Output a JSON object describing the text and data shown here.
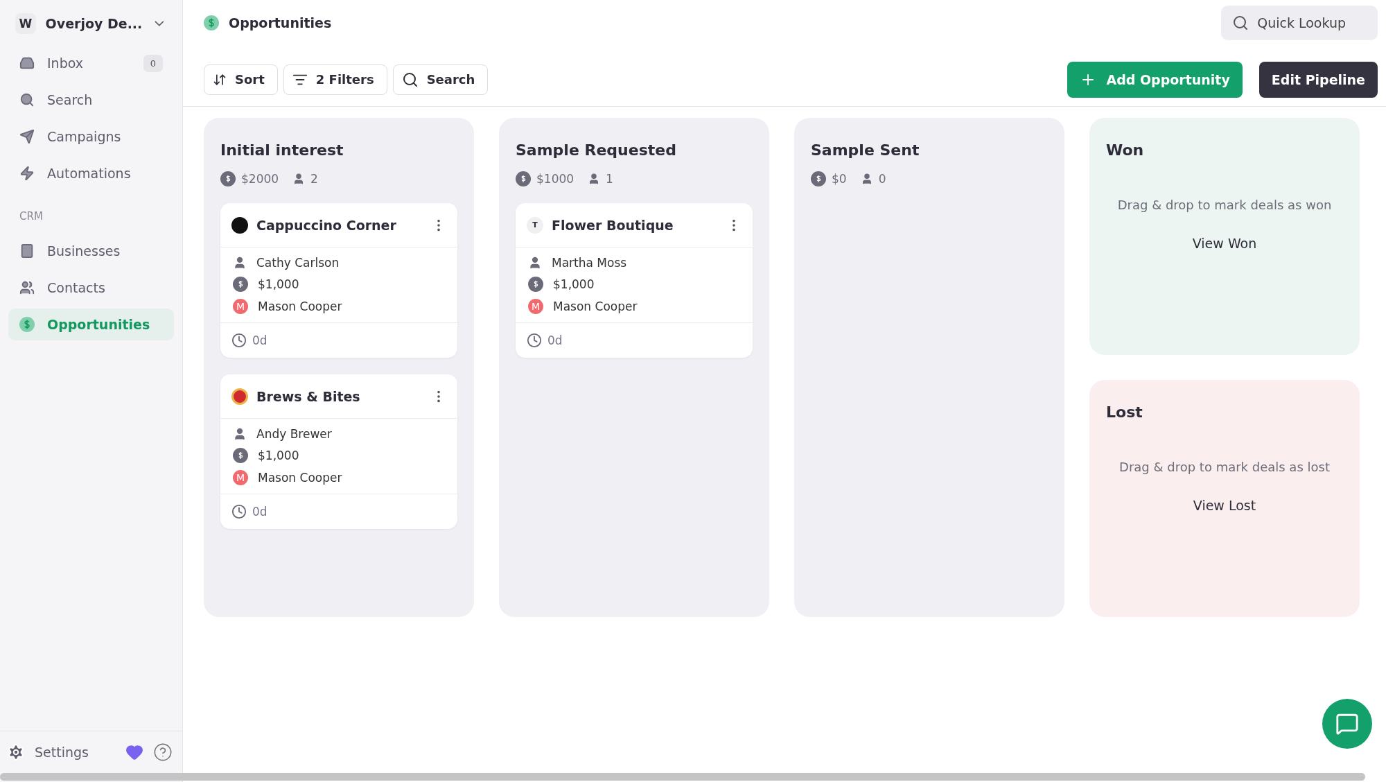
{
  "workspace": {
    "initial": "W",
    "name": "Overjoy De..."
  },
  "nav": [
    {
      "label": "Inbox",
      "kind": "inbox",
      "badge": "0",
      "selected": false
    },
    {
      "label": "Search",
      "kind": "search",
      "selected": false
    },
    {
      "label": "Campaigns",
      "kind": "send",
      "selected": false
    },
    {
      "label": "Automations",
      "kind": "bolt",
      "selected": false
    }
  ],
  "crm_section": {
    "heading": "CRM",
    "items": [
      {
        "label": "Businesses",
        "kind": "building",
        "selected": false
      },
      {
        "label": "Contacts",
        "kind": "contacts",
        "selected": false
      },
      {
        "label": "Opportunities",
        "kind": "dollar",
        "selected": true
      }
    ]
  },
  "sidebar_footer": {
    "settings": "Settings"
  },
  "header": {
    "title": "Opportunities",
    "quick_lookup": "Quick Lookup"
  },
  "toolbar": {
    "sort": "Sort",
    "filters": "2 Filters",
    "search": "Search",
    "add": "Add Opportunity",
    "edit": "Edit Pipeline"
  },
  "columns": [
    {
      "kind": "stage",
      "title": "Initial interest",
      "total": "$2000",
      "count": "2",
      "cards": [
        {
          "name": "Cappuccino Corner",
          "logo": {
            "kind": "dark"
          },
          "contact": "Cathy Carlson",
          "value": "$1,000",
          "owner_initial": "M",
          "owner": "Mason Cooper",
          "age": "0d"
        },
        {
          "name": "Brews & Bites",
          "logo": {
            "kind": "badge"
          },
          "contact": "Andy Brewer",
          "value": "$1,000",
          "owner_initial": "M",
          "owner": "Mason Cooper",
          "age": "0d"
        }
      ]
    },
    {
      "kind": "stage",
      "title": "Sample Requested",
      "total": "$1000",
      "count": "1",
      "cards": [
        {
          "name": "Flower Boutique",
          "logo": {
            "kind": "letter",
            "letter": "T"
          },
          "contact": "Martha Moss",
          "value": "$1,000",
          "owner_initial": "M",
          "owner": "Mason Cooper",
          "age": "0d"
        }
      ]
    },
    {
      "kind": "stage",
      "title": "Sample Sent",
      "total": "$0",
      "count": "0"
    },
    {
      "kind": "won",
      "title": "Won",
      "hint": "Drag & drop to mark deals as won",
      "link": "View Won"
    },
    {
      "kind": "lost",
      "title": "Lost",
      "hint": "Drag & drop to mark deals as lost",
      "link": "View Lost"
    }
  ]
}
